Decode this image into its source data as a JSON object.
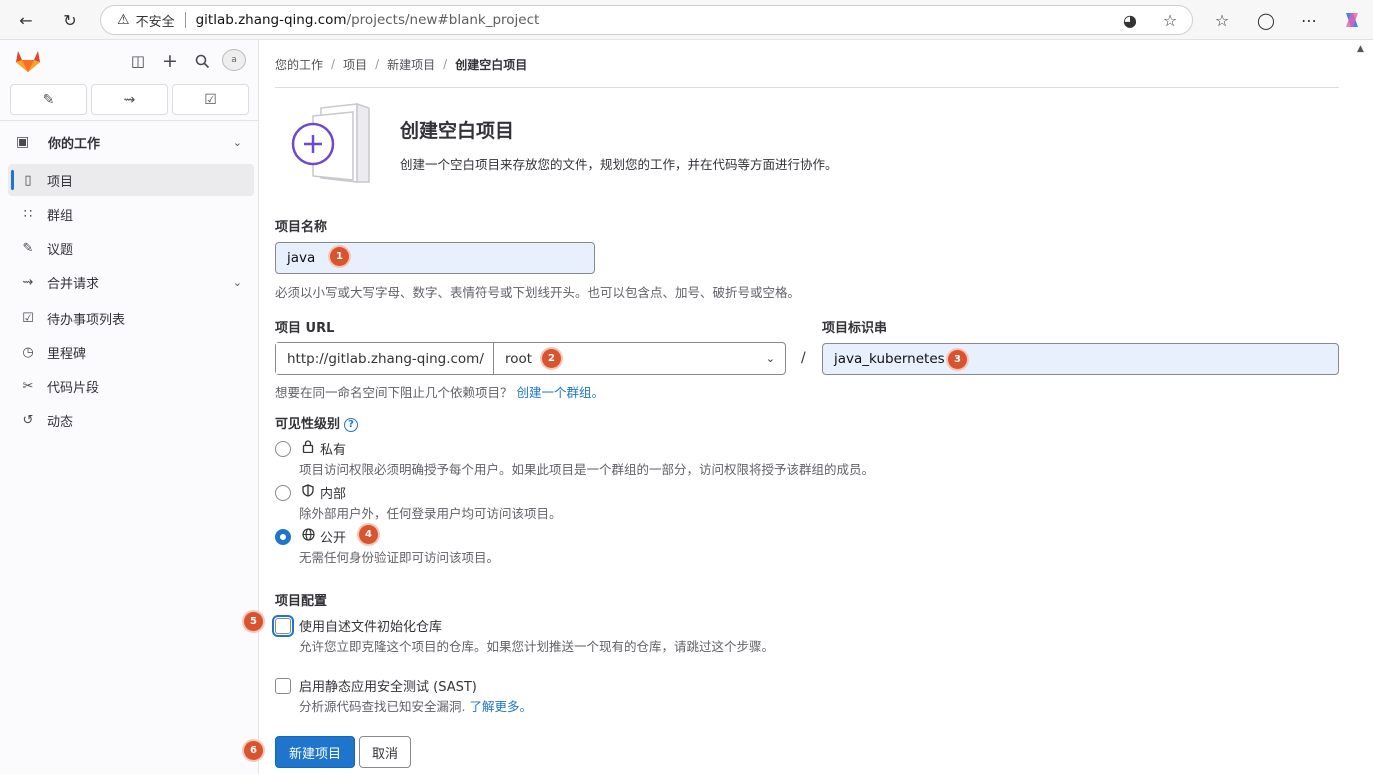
{
  "browser": {
    "insecure_label": "不安全",
    "url_host": "gitlab.zhang-qing.com",
    "url_path": "/projects/new#blank_project"
  },
  "sidebar": {
    "avatar_alt": "a",
    "context_label": "你的工作",
    "items": [
      {
        "label": "项目",
        "icon": "project-icon"
      },
      {
        "label": "群组",
        "icon": "group-icon"
      },
      {
        "label": "议题",
        "icon": "issues-icon"
      },
      {
        "label": "合并请求",
        "icon": "merge-request-icon"
      },
      {
        "label": "待办事项列表",
        "icon": "todo-icon"
      },
      {
        "label": "里程碑",
        "icon": "milestone-icon"
      },
      {
        "label": "代码片段",
        "icon": "snippet-icon"
      },
      {
        "label": "动态",
        "icon": "activity-icon"
      }
    ]
  },
  "breadcrumb": [
    "您的工作",
    "项目",
    "新建项目",
    "创建空白项目"
  ],
  "hero": {
    "title": "创建空白项目",
    "description": "创建一个空白项目来存放您的文件，规划您的工作，并在代码等方面进行协作。"
  },
  "form": {
    "name_label": "项目名称",
    "name_value": "java",
    "name_help": "必须以小写或大写字母、数字、表情符号或下划线开头。也可以包含点、加号、破折号或空格。",
    "url_label": "项目 URL",
    "url_prefix": "http://gitlab.zhang-qing.com/",
    "url_namespace": "root",
    "slug_label": "项目标识串",
    "slug_value": "java_kubernetes",
    "group_help": "想要在同一命名空间下阻止几个依赖项目？",
    "group_help_link": "创建一个群组。",
    "visibility_label": "可见性级别",
    "visibility": [
      {
        "label": "私有",
        "icon": "lock-icon",
        "desc": "项目访问权限必须明确授予每个用户。如果此项目是一个群组的一部分，访问权限将授予该群组的成员。",
        "checked": false
      },
      {
        "label": "内部",
        "icon": "shield-icon",
        "desc": "除外部用户外，任何登录用户均可访问该项目。",
        "checked": false
      },
      {
        "label": "公开",
        "icon": "globe-icon",
        "desc": "无需任何身份验证即可访问该项目。",
        "checked": true
      }
    ],
    "config_label": "项目配置",
    "readme_label": "使用自述文件初始化仓库",
    "readme_desc": "允许您立即克隆这个项目的仓库。如果您计划推送一个现有的仓库，请跳过这个步骤。",
    "sast_label": "启用静态应用安全测试 (SAST)",
    "sast_desc": "分析源代码查找已知安全漏洞.",
    "sast_link": "了解更多。",
    "submit_label": "新建项目",
    "cancel_label": "取消"
  },
  "annotations": [
    "1",
    "2",
    "3",
    "4",
    "5",
    "6"
  ],
  "colors": {
    "primary": "#1f75cb",
    "badge": "#d9532f"
  }
}
